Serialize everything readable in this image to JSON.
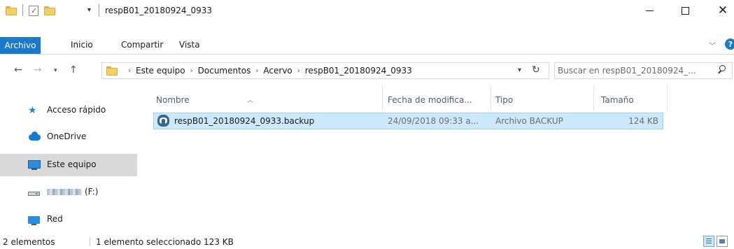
{
  "window": {
    "title": "respB01_20180924_0933"
  },
  "ribbon": {
    "tabs": [
      "Archivo",
      "Inicio",
      "Compartir",
      "Vista"
    ]
  },
  "address": {
    "crumbs": [
      "Este equipo",
      "Documentos",
      "Acervo",
      "respB01_20180924_0933"
    ]
  },
  "search": {
    "placeholder": "Buscar en respB01_20180924_..."
  },
  "sidebar": {
    "items": [
      {
        "label": "Acceso rápido",
        "icon": "quick-access-star-icon"
      },
      {
        "label": "OneDrive",
        "icon": "onedrive-cloud-icon"
      },
      {
        "label": "Este equipo",
        "icon": "this-pc-monitor-icon",
        "selected": true
      },
      {
        "label": "(F:)",
        "icon": "drive-icon"
      },
      {
        "label": "Red",
        "icon": "network-icon"
      }
    ]
  },
  "columns": {
    "name": "Nombre",
    "modified": "Fecha de modifica...",
    "type": "Tipo",
    "size": "Tamaño"
  },
  "files": [
    {
      "name": "respB01_20180924_0933.backup",
      "modified": "24/09/2018 09:33 a...",
      "type": "Archivo BACKUP",
      "size": "124 KB",
      "icon": "postgresql-elephant-icon",
      "selected": true
    }
  ],
  "status": {
    "count": "2 elementos",
    "selection": "1 elemento seleccionado  123 KB"
  },
  "colors": {
    "accent": "#1979ca",
    "selection_bg": "#cce8ff",
    "selection_border": "#99d1ff",
    "header_text": "#4c607a"
  }
}
